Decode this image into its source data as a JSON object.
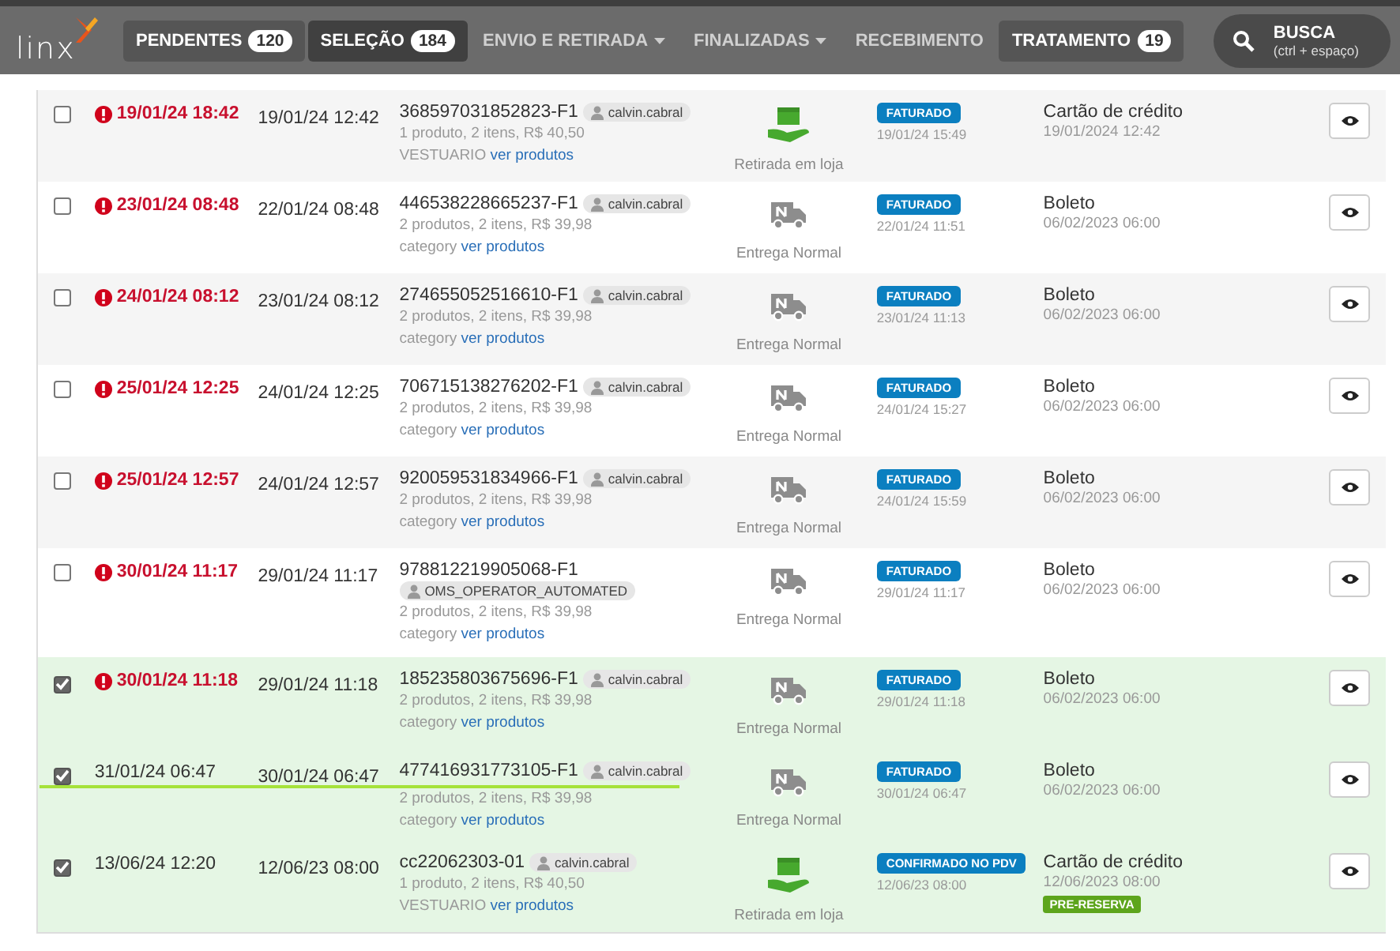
{
  "logo": "linx",
  "tabs": [
    {
      "label": "PENDENTES",
      "count": "120",
      "selected": false,
      "dropdown": false
    },
    {
      "label": "SELEÇÃO",
      "count": "184",
      "selected": true,
      "dropdown": false
    },
    {
      "label": "ENVIO E RETIRADA",
      "selected": false,
      "dropdown": true
    },
    {
      "label": "FINALIZADAS",
      "selected": false,
      "dropdown": true
    },
    {
      "label": "RECEBIMENTO",
      "selected": false,
      "dropdown": false
    },
    {
      "label": "TRATAMENTO",
      "count": "19",
      "selected": false,
      "dropdown": false
    }
  ],
  "search": {
    "label": "BUSCA",
    "shortcut": "(ctrl + espaço)"
  },
  "orders": [
    {
      "selected": false,
      "overdue": true,
      "underlined": false,
      "deadline": "19/01/24 18:42",
      "created": "19/01/24 12:42",
      "order_id": "368597031852823-F1",
      "operator": "calvin.cabral",
      "summary": "1 produto, 2 itens, R$ 40,50",
      "category": "VESTUARIO",
      "link": "ver produtos",
      "kind": "pickup",
      "delivery": "Retirada em loja",
      "status": "FATURADO",
      "status_time": "19/01/24 15:49",
      "payment": "Cartão de crédito",
      "payment_time": "19/01/2024 12:42"
    },
    {
      "selected": false,
      "overdue": true,
      "underlined": false,
      "deadline": "23/01/24 08:48",
      "created": "22/01/24 08:48",
      "order_id": "446538228665237-F1",
      "operator": "calvin.cabral",
      "summary": "2 produtos, 2 itens, R$ 39,98",
      "category": "category",
      "link": "ver produtos",
      "kind": "truck",
      "delivery": "Entrega Normal",
      "status": "FATURADO",
      "status_time": "22/01/24 11:51",
      "payment": "Boleto",
      "payment_time": "06/02/2023 06:00"
    },
    {
      "selected": false,
      "overdue": true,
      "underlined": false,
      "deadline": "24/01/24 08:12",
      "created": "23/01/24 08:12",
      "order_id": "274655052516610-F1",
      "operator": "calvin.cabral",
      "summary": "2 produtos, 2 itens, R$ 39,98",
      "category": "category",
      "link": "ver produtos",
      "kind": "truck",
      "delivery": "Entrega Normal",
      "status": "FATURADO",
      "status_time": "23/01/24 11:13",
      "payment": "Boleto",
      "payment_time": "06/02/2023 06:00"
    },
    {
      "selected": false,
      "overdue": true,
      "underlined": false,
      "deadline": "25/01/24 12:25",
      "created": "24/01/24 12:25",
      "order_id": "706715138276202-F1",
      "operator": "calvin.cabral",
      "summary": "2 produtos, 2 itens, R$ 39,98",
      "category": "category",
      "link": "ver produtos",
      "kind": "truck",
      "delivery": "Entrega Normal",
      "status": "FATURADO",
      "status_time": "24/01/24 15:27",
      "payment": "Boleto",
      "payment_time": "06/02/2023 06:00"
    },
    {
      "selected": false,
      "overdue": true,
      "underlined": false,
      "deadline": "25/01/24 12:57",
      "created": "24/01/24 12:57",
      "order_id": "920059531834966-F1",
      "operator": "calvin.cabral",
      "summary": "2 produtos, 2 itens, R$ 39,98",
      "category": "category",
      "link": "ver produtos",
      "kind": "truck",
      "delivery": "Entrega Normal",
      "status": "FATURADO",
      "status_time": "24/01/24 15:59",
      "payment": "Boleto",
      "payment_time": "06/02/2023 06:00"
    },
    {
      "selected": false,
      "overdue": true,
      "underlined": false,
      "deadline": "30/01/24 11:17",
      "created": "29/01/24 11:17",
      "order_id": "978812219905068-F1",
      "operator": "OMS_OPERATOR_AUTOMATED",
      "operator_wrapped": true,
      "summary": "2 produtos, 2 itens, R$ 39,98",
      "category": "category",
      "link": "ver produtos",
      "kind": "truck",
      "delivery": "Entrega Normal",
      "status": "FATURADO",
      "status_time": "29/01/24 11:17",
      "payment": "Boleto",
      "payment_time": "06/02/2023 06:00"
    },
    {
      "selected": true,
      "overdue": true,
      "underlined": false,
      "deadline": "30/01/24 11:18",
      "created": "29/01/24 11:18",
      "order_id": "185235803675696-F1",
      "operator": "calvin.cabral",
      "summary": "2 produtos, 2 itens, R$ 39,98",
      "category": "category",
      "link": "ver produtos",
      "kind": "truck",
      "delivery": "Entrega Normal",
      "status": "FATURADO",
      "status_time": "29/01/24 11:18",
      "payment": "Boleto",
      "payment_time": "06/02/2023 06:00"
    },
    {
      "selected": true,
      "overdue": false,
      "underlined": true,
      "deadline": "31/01/24 06:47",
      "created": "30/01/24 06:47",
      "order_id": "477416931773105-F1",
      "operator": "calvin.cabral",
      "summary": "2 produtos, 2 itens, R$ 39,98",
      "category": "category",
      "link": "ver produtos",
      "kind": "truck",
      "delivery": "Entrega Normal",
      "status": "FATURADO",
      "status_time": "30/01/24 06:47",
      "payment": "Boleto",
      "payment_time": "06/02/2023 06:00"
    },
    {
      "selected": true,
      "overdue": false,
      "underlined": false,
      "deadline": "13/06/24 12:20",
      "created": "12/06/23 08:00",
      "order_id": "cc22062303-01",
      "operator": "calvin.cabral",
      "summary": "1 produto, 2 itens, R$ 40,50",
      "category": "VESTUARIO",
      "link": "ver produtos",
      "kind": "pickup",
      "delivery": "Retirada em loja",
      "status": "CONFIRMADO NO PDV",
      "status_time": "12/06/23 08:00",
      "payment": "Cartão de crédito",
      "payment_time": "12/06/2023 08:00",
      "tag": "PRE-RESERVA"
    }
  ]
}
